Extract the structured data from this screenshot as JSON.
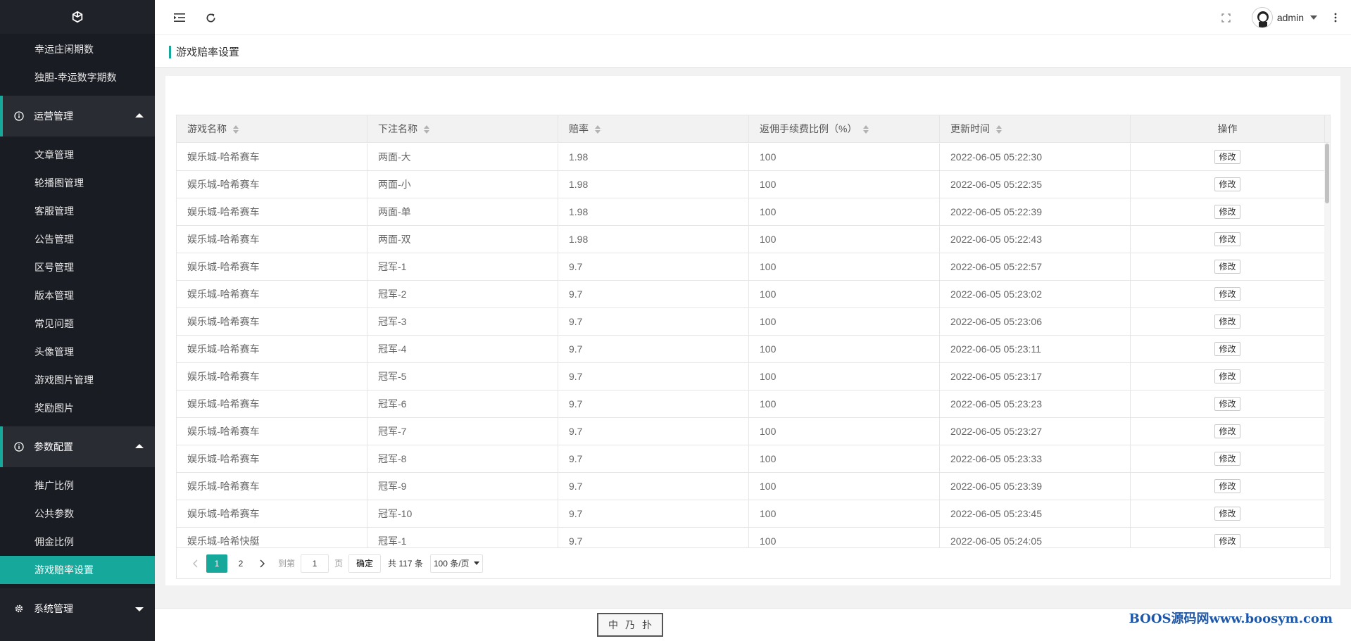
{
  "sidebar": {
    "top_items": [
      "幸运庄闲期数",
      "独胆-幸运数字期数"
    ],
    "group1": {
      "label": "运营管理",
      "items": [
        "文章管理",
        "轮播图管理",
        "客服管理",
        "公告管理",
        "区号管理",
        "版本管理",
        "常见问题",
        "头像管理",
        "游戏图片管理",
        "奖励图片"
      ]
    },
    "group2": {
      "label": "参数配置",
      "items": [
        "推广比例",
        "公共参数",
        "佣金比例",
        "游戏赔率设置"
      ]
    },
    "group3": {
      "label": "系统管理"
    },
    "accent": "#16a89a"
  },
  "header": {
    "username": "admin"
  },
  "page": {
    "title": "游戏赔率设置"
  },
  "table": {
    "columns": [
      "游戏名称",
      "下注名称",
      "赔率",
      "返佣手续费比例（%）",
      "更新时间",
      "操作"
    ],
    "edit_label": "修改",
    "rows": [
      [
        "娱乐城-哈希赛车",
        "两面-大",
        "1.98",
        "100",
        "2022-06-05 05:22:30"
      ],
      [
        "娱乐城-哈希赛车",
        "两面-小",
        "1.98",
        "100",
        "2022-06-05 05:22:35"
      ],
      [
        "娱乐城-哈希赛车",
        "两面-单",
        "1.98",
        "100",
        "2022-06-05 05:22:39"
      ],
      [
        "娱乐城-哈希赛车",
        "两面-双",
        "1.98",
        "100",
        "2022-06-05 05:22:43"
      ],
      [
        "娱乐城-哈希赛车",
        "冠军-1",
        "9.7",
        "100",
        "2022-06-05 05:22:57"
      ],
      [
        "娱乐城-哈希赛车",
        "冠军-2",
        "9.7",
        "100",
        "2022-06-05 05:23:02"
      ],
      [
        "娱乐城-哈希赛车",
        "冠军-3",
        "9.7",
        "100",
        "2022-06-05 05:23:06"
      ],
      [
        "娱乐城-哈希赛车",
        "冠军-4",
        "9.7",
        "100",
        "2022-06-05 05:23:11"
      ],
      [
        "娱乐城-哈希赛车",
        "冠军-5",
        "9.7",
        "100",
        "2022-06-05 05:23:17"
      ],
      [
        "娱乐城-哈希赛车",
        "冠军-6",
        "9.7",
        "100",
        "2022-06-05 05:23:23"
      ],
      [
        "娱乐城-哈希赛车",
        "冠军-7",
        "9.7",
        "100",
        "2022-06-05 05:23:27"
      ],
      [
        "娱乐城-哈希赛车",
        "冠军-8",
        "9.7",
        "100",
        "2022-06-05 05:23:33"
      ],
      [
        "娱乐城-哈希赛车",
        "冠军-9",
        "9.7",
        "100",
        "2022-06-05 05:23:39"
      ],
      [
        "娱乐城-哈希赛车",
        "冠军-10",
        "9.7",
        "100",
        "2022-06-05 05:23:45"
      ],
      [
        "娱乐城-哈希快艇",
        "冠军-1",
        "9.7",
        "100",
        "2022-06-05 05:24:05"
      ]
    ]
  },
  "pager": {
    "pages": [
      "1",
      "2"
    ],
    "goto_label": "到第",
    "page_value": "1",
    "page_unit": "页",
    "confirm_label": "确定",
    "total_text": "共 117 条",
    "page_size": "100 条/页"
  },
  "footer": {
    "stamp": [
      "中",
      "乃",
      "扑"
    ],
    "watermark": "BOOS源码网www.boosym.com"
  }
}
